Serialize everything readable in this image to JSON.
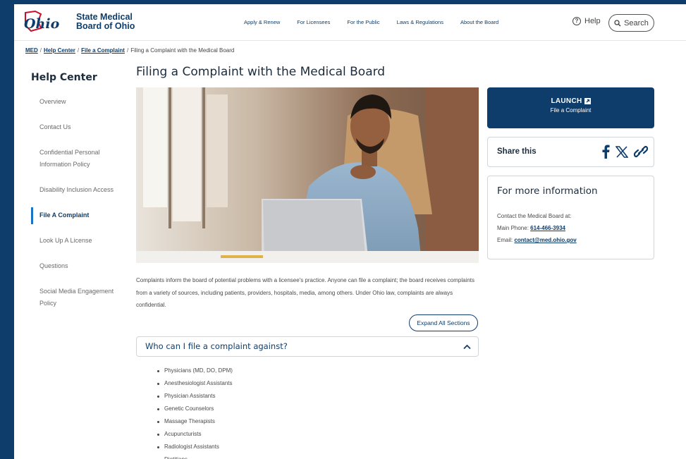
{
  "header": {
    "logo_script": "Ohio",
    "logo_line1": "State Medical",
    "logo_line2": "Board of Ohio",
    "nav": [
      "Apply & Renew",
      "For Licensees",
      "For the Public",
      "Laws & Regulations",
      "About the Board"
    ],
    "help_label": "Help",
    "search_label": "Search"
  },
  "breadcrumb": {
    "items": [
      "MED",
      "Help Center",
      "File a Complaint"
    ],
    "current": "Filing a Complaint with the Medical Board"
  },
  "sidebar": {
    "title": "Help Center",
    "items": [
      "Overview",
      "Contact Us",
      "Confidential Personal Information Policy",
      "Disability Inclusion Access",
      "File A Complaint",
      "Look Up A License",
      "Questions",
      "Social Media Engagement Policy"
    ],
    "active_index": 4
  },
  "main": {
    "title": "Filing a Complaint with the Medical Board",
    "intro": "Complaints inform the board of potential problems with a licensee's practice. Anyone can file a complaint; the board receives complaints from a variety of sources, including patients, providers, hospitals, media, among others. Under Ohio law, complaints are always confidential.",
    "expand_label": "Expand All Sections",
    "accordion_title": "Who can I file a complaint against?",
    "list": [
      "Physicians (MD, DO, DPM)",
      "Anesthesiologist Assistants",
      "Physician Assistants",
      "Genetic Counselors",
      "Massage Therapists",
      "Acupuncturists",
      "Radiologist Assistants",
      "Dietitians"
    ]
  },
  "right": {
    "launch_label": "LAUNCH",
    "launch_sub": "File a Complaint",
    "share_label": "Share this",
    "info_title": "For more information",
    "info_line1": "Contact the Medical Board at:",
    "phone_prefix": "Main Phone: ",
    "phone": "614-466-3934",
    "email_prefix": "Email: ",
    "email": "contact@med.ohio.gov"
  },
  "colors": {
    "brand_navy": "#0f3d6b",
    "accent_red": "#c8102e",
    "active_bar": "#1a73c4"
  }
}
